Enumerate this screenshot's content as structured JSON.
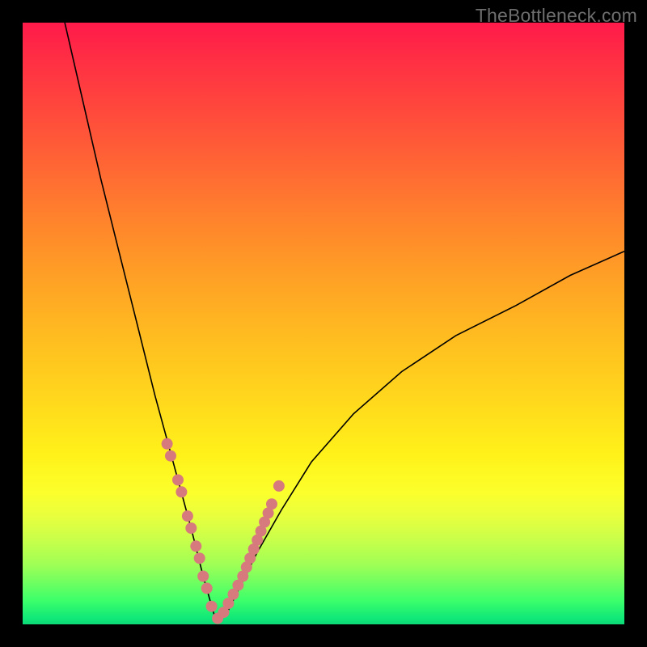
{
  "watermark": "TheBottleneck.com",
  "colors": {
    "frame": "#000000",
    "curve": "#000000",
    "dots": "#d77a7d",
    "gradient_stops": [
      "#ff1a4a",
      "#ff4a3c",
      "#ff8a2a",
      "#ffc41f",
      "#fff21a",
      "#c8ff4a",
      "#3cff6a",
      "#0dd877"
    ]
  },
  "chart_data": {
    "type": "line",
    "title": "",
    "xlabel": "",
    "ylabel": "",
    "xlim": [
      0,
      100
    ],
    "ylim": [
      0,
      100
    ],
    "comment": "V-shaped bottleneck curve. Minimum near x≈32 at y≈0. Left branch rises to y≈100 at x≈7; right branch rises to y≈62 at x≈100. Dots are sample points on the curve near the minimum.",
    "series": [
      {
        "name": "bottleneck-curve",
        "x": [
          7,
          10,
          13,
          16,
          19,
          22,
          25,
          28,
          30,
          32,
          34,
          36,
          39,
          43,
          48,
          55,
          63,
          72,
          82,
          91,
          100
        ],
        "y": [
          100,
          87,
          74,
          62,
          50,
          38,
          27,
          16,
          8,
          1,
          2,
          6,
          12,
          19,
          27,
          35,
          42,
          48,
          53,
          58,
          62
        ]
      }
    ],
    "points": {
      "name": "sample-dots",
      "x": [
        24.0,
        24.6,
        25.8,
        26.4,
        27.4,
        28.0,
        28.8,
        29.4,
        30.0,
        30.6,
        31.4,
        32.4,
        33.4,
        34.2,
        35.0,
        35.8,
        36.6,
        37.2,
        37.8,
        38.4,
        39.0,
        39.6,
        40.2,
        40.8,
        41.4,
        42.6
      ],
      "y": [
        30.0,
        28.0,
        24.0,
        22.0,
        18.0,
        16.0,
        13.0,
        11.0,
        8.0,
        6.0,
        3.0,
        1.0,
        2.0,
        3.5,
        5.0,
        6.5,
        8.0,
        9.5,
        11.0,
        12.5,
        14.0,
        15.5,
        17.0,
        18.5,
        20.0,
        23.0
      ]
    }
  }
}
